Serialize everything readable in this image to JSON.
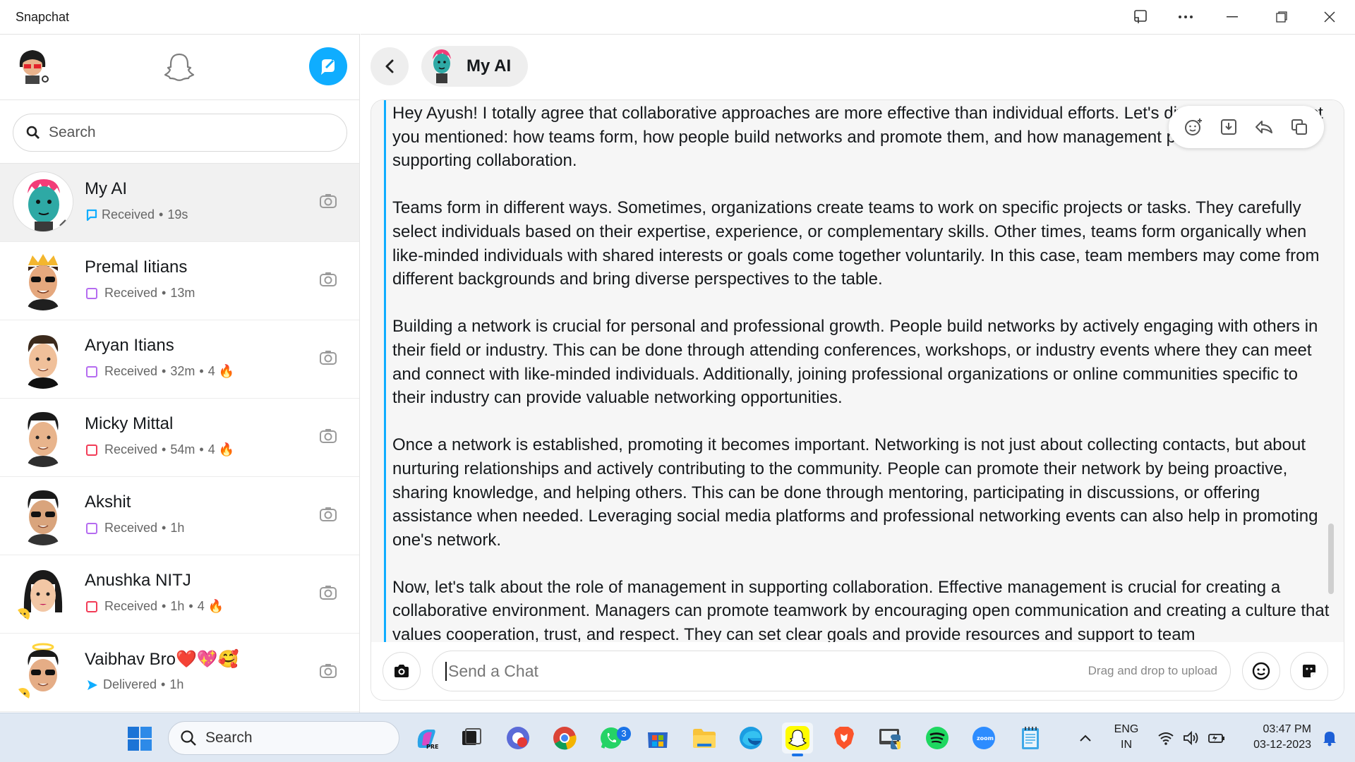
{
  "window": {
    "title": "Snapchat"
  },
  "sidebar": {
    "search_placeholder": "Search",
    "chats": [
      {
        "name": "My AI",
        "status": "Received",
        "time": "19s",
        "streak": "",
        "status_color": "#0fadff",
        "active": true
      },
      {
        "name": "Premal Iitians",
        "status": "Received",
        "time": "13m",
        "streak": "",
        "status_color": "#b56cf0",
        "active": false
      },
      {
        "name": "Aryan Itians",
        "status": "Received",
        "time": "32m",
        "streak": "4 🔥",
        "status_color": "#b56cf0",
        "active": false
      },
      {
        "name": "Micky Mittal",
        "status": "Received",
        "time": "54m",
        "streak": "4 🔥",
        "status_color": "#f23c57",
        "active": false
      },
      {
        "name": "Akshit",
        "status": "Received",
        "time": "1h",
        "streak": "",
        "status_color": "#b56cf0",
        "active": false
      },
      {
        "name": "Anushka NITJ",
        "status": "Received",
        "time": "1h",
        "streak": "4 🔥",
        "status_color": "#f23c57",
        "active": false
      },
      {
        "name": "Vaibhav Bro❤️💖🥰",
        "status": "Delivered",
        "time": "1h",
        "streak": "",
        "status_color": "#0fadff",
        "active": false
      }
    ]
  },
  "chat": {
    "title": "My AI",
    "messages": [
      "Hey Ayush! I totally agree that collaborative approaches are more effective than individual efforts. Let's dive into each aspect you mentioned: how teams form, how people build networks and promote them, and how management plays a role in supporting collaboration.",
      "Teams form in different ways. Sometimes, organizations create teams to work on specific projects or tasks. They carefully select individuals based on their expertise, experience, or complementary skills. Other times, teams form organically when like-minded individuals with shared interests or goals come together voluntarily. In this case, team members may come from different backgrounds and bring diverse perspectives to the table.",
      "Building a network is crucial for personal and professional growth. People build networks by actively engaging with others in their field or industry. This can be done through attending conferences, workshops, or industry events where they can meet and connect with like-minded individuals. Additionally, joining professional organizations or online communities specific to their industry can provide valuable networking opportunities.",
      "Once a network is established, promoting it becomes important. Networking is not just about collecting contacts, but about nurturing relationships and actively contributing to the community. People can promote their network by being proactive, sharing knowledge, and helping others. This can be done through mentoring, participating in discussions, or offering assistance when needed. Leveraging social media platforms and professional networking events can also help in promoting one's network.",
      "Now, let's talk about the role of management in supporting collaboration. Effective management is crucial for creating a collaborative environment. Managers can promote teamwork by encouraging open communication and creating a culture that values cooperation, trust, and respect. They can set clear goals and provide resources and support to team"
    ],
    "input_placeholder": "Send a Chat",
    "drag_drop_hint": "Drag and drop to upload"
  },
  "taskbar": {
    "search_label": "Search",
    "whatsapp_badge": "3",
    "language": "ENG",
    "region": "IN",
    "time": "03:47 PM",
    "date": "03-12-2023"
  },
  "colors": {
    "accent": "#0fadff",
    "taskbar": "#dfe8f3"
  }
}
